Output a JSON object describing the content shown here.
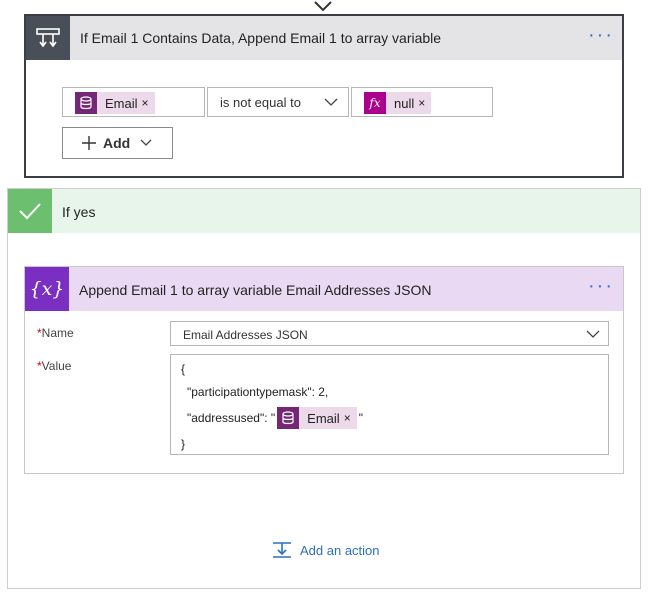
{
  "condition": {
    "title": "If Email 1 Contains Data, Append Email 1 to array variable",
    "menu": "···",
    "left_token": {
      "label": "Email",
      "icon": "database-icon",
      "color": "#742774"
    },
    "operator": "is not equal to",
    "right_token": {
      "label": "null",
      "icon": "fx-icon",
      "color": "#ad008c"
    },
    "add_label": "Add",
    "remove_glyph": "×"
  },
  "if_yes": {
    "title": "If yes",
    "color": "#6bbf6e"
  },
  "append": {
    "title": "Append Email 1 to array variable Email Addresses JSON",
    "menu": "···",
    "icon_glyph": "{x}",
    "required_mark": "*",
    "name_label": "Name",
    "name_value": "Email Addresses JSON",
    "value_label": "Value",
    "value_lines": {
      "open": "{",
      "line1": "\"participationtypemask\": 2,",
      "line2_prefix": "\"addressused\": \"",
      "line2_token": "Email",
      "line2_suffix": "\"",
      "close": "}"
    },
    "color": "#7b2fc2"
  },
  "add_action": {
    "label": "Add an action"
  }
}
